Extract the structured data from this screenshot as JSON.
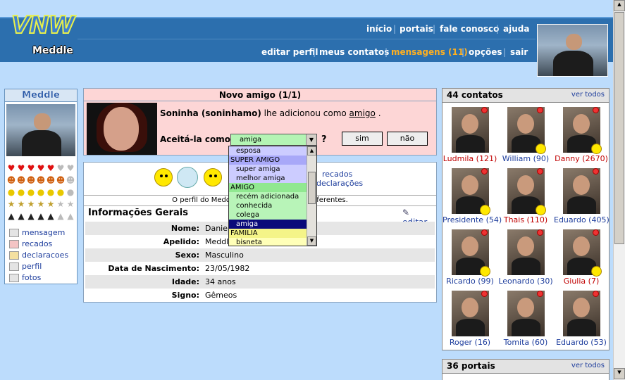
{
  "header": {
    "logo": "VNW",
    "brand": "Meddle",
    "nav_top": [
      "início",
      "portais",
      "fale conosco",
      "ajuda"
    ],
    "nav_bottom": [
      "editar perfil",
      "meus contatos",
      "mensagens (11)",
      "opções",
      "sair"
    ],
    "highlight_color": "#ffb020"
  },
  "left": {
    "title": "Meddle",
    "menu": [
      "mensagem",
      "recados",
      "declaracoes",
      "perfil",
      "fotos"
    ]
  },
  "notice": {
    "title": "Novo amigo (1/1)",
    "name": "Soninha (soninhamo)",
    "text_mid": " lhe adicionou como ",
    "relation": "amigo",
    "text_end": " .",
    "accept_label": "Aceitá-la como",
    "selected": "amiga",
    "question": "?",
    "yes": "sim",
    "no": "não"
  },
  "dropdown": {
    "items": [
      {
        "label": "esposa",
        "group": false,
        "bg": "#ccccff"
      },
      {
        "label": "SUPER AMIGO",
        "group": true,
        "bg": "#a8a8f8"
      },
      {
        "label": "super amiga",
        "group": false,
        "bg": "#ccccff"
      },
      {
        "label": "melhor amiga",
        "group": false,
        "bg": "#ccccff"
      },
      {
        "label": "AMIGO",
        "group": true,
        "bg": "#90e890"
      },
      {
        "label": "recém adicionada",
        "group": false,
        "bg": "#b8f4b8"
      },
      {
        "label": "conhecida",
        "group": false,
        "bg": "#b8f4b8"
      },
      {
        "label": "colega",
        "group": false,
        "bg": "#b8f4b8"
      },
      {
        "label": "amiga",
        "group": false,
        "bg": "#0a0a7a"
      },
      {
        "label": "FAMILIA",
        "group": true,
        "bg": "#f4f488"
      },
      {
        "label": "bisneta",
        "group": false,
        "bg": "#ffffb8"
      }
    ]
  },
  "main": {
    "recados": "recados",
    "declaracoes": "declarações",
    "visits": "O perfil do Meddle foi visto ... usuários diferentes.",
    "info_title": "Informações Gerais",
    "edit": "editar",
    "rows": [
      {
        "label": "Nome:",
        "value": "Danie"
      },
      {
        "label": "Apelido:",
        "value": "Meddl"
      },
      {
        "label": "Sexo:",
        "value": "Masculino"
      },
      {
        "label": "Data de Nascimento:",
        "value": "23/05/1982"
      },
      {
        "label": "Idade:",
        "value": "34 anos"
      },
      {
        "label": "Signo:",
        "value": "Gêmeos"
      }
    ]
  },
  "contacts": {
    "title": "44 contatos",
    "view_all": "ver todos",
    "list": [
      {
        "name": "Ludmila (121)",
        "color": "#c00000",
        "smiley": false
      },
      {
        "name": "William (90)",
        "color": "#1c3c9c",
        "smiley": true
      },
      {
        "name": "Danny (2670)",
        "color": "#c00000",
        "smiley": true
      },
      {
        "name": "Presidente (54)",
        "color": "#1c3c9c",
        "smiley": true
      },
      {
        "name": "Thais (110)",
        "color": "#c00000",
        "smiley": true
      },
      {
        "name": "Eduardo (405)",
        "color": "#1c3c9c",
        "smiley": false
      },
      {
        "name": "Ricardo (99)",
        "color": "#1c3c9c",
        "smiley": true
      },
      {
        "name": "Leonardo (30)",
        "color": "#1c3c9c",
        "smiley": false
      },
      {
        "name": "Giulia (7)",
        "color": "#c00000",
        "smiley": true
      },
      {
        "name": "Roger (16)",
        "color": "#1c3c9c",
        "smiley": false
      },
      {
        "name": "Tomita (60)",
        "color": "#1c3c9c",
        "smiley": false
      },
      {
        "name": "Eduardo (53)",
        "color": "#1c3c9c",
        "smiley": false
      }
    ]
  },
  "portais": {
    "title": "36 portais",
    "view_all": "ver todos"
  }
}
